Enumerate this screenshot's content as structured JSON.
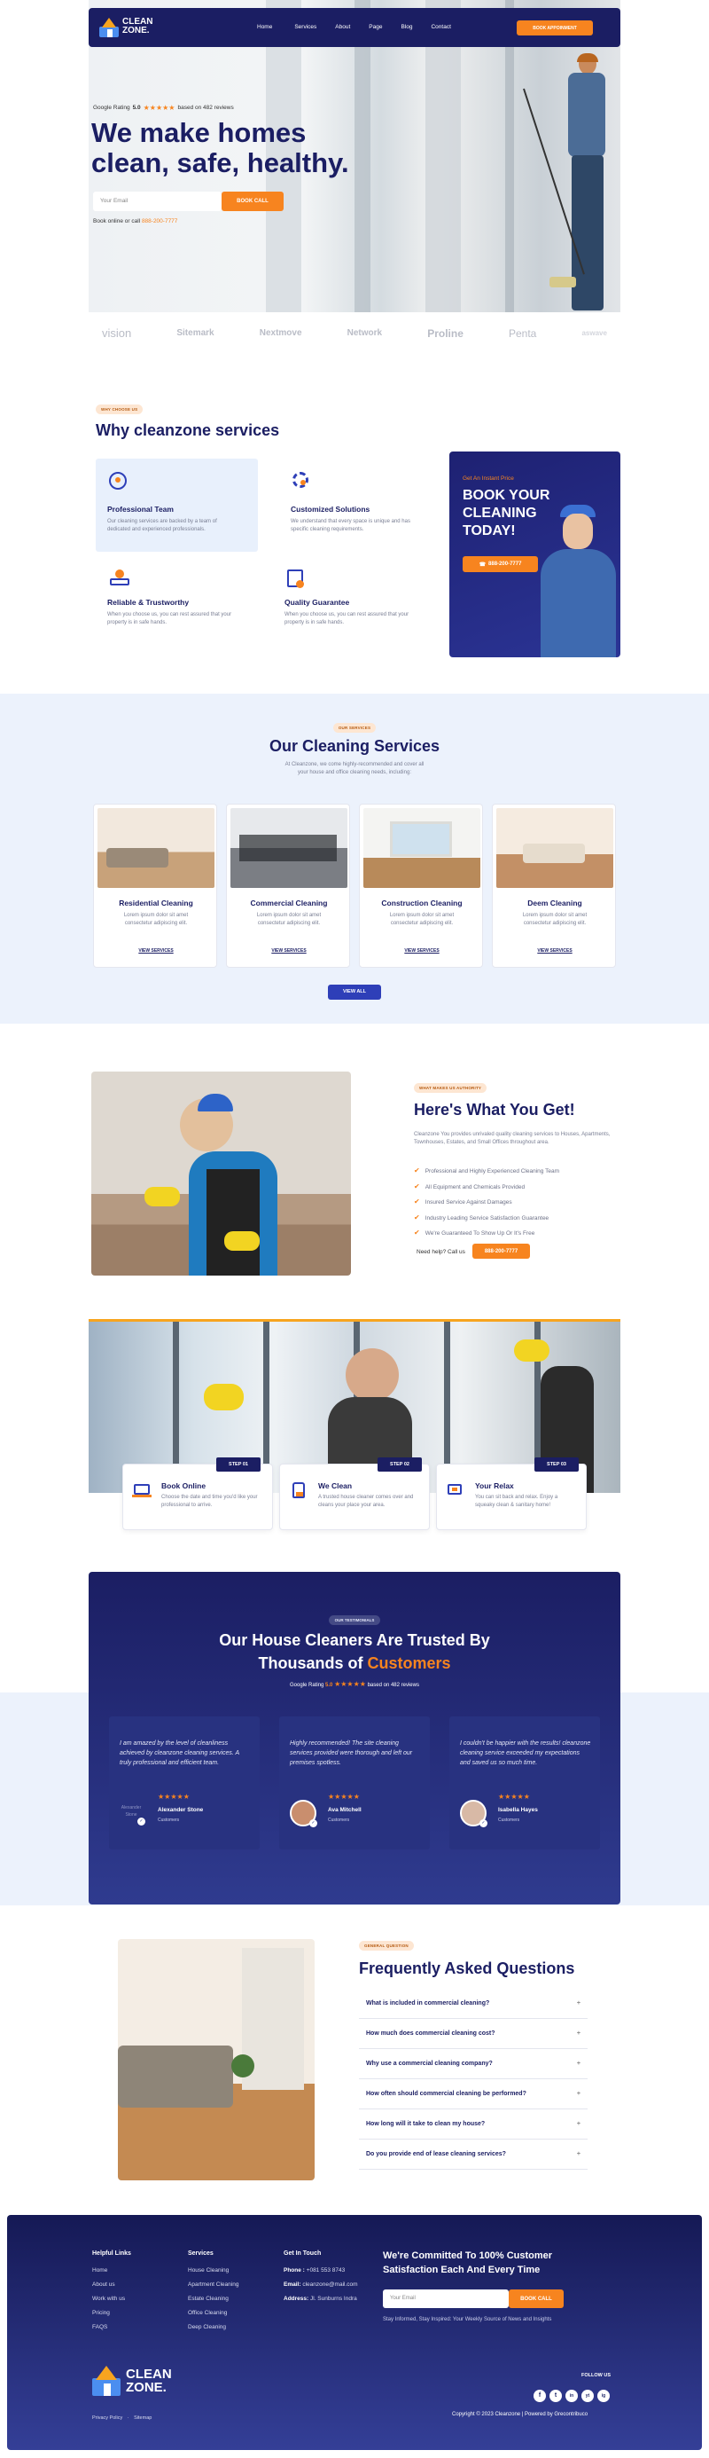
{
  "brand": {
    "logo_line1": "CLEAN",
    "logo_line2": "ZONE."
  },
  "nav": {
    "items": [
      "Home",
      "Services",
      "About",
      "Page",
      "Blog",
      "Contact"
    ],
    "cta": "BOOK APPOINMENT"
  },
  "hero": {
    "rating_label": "Google Rating",
    "rating_value": "5.0",
    "stars": "★★★★★",
    "rating_suffix": "based on 482 reviews",
    "title_line1": "We make homes",
    "title_line2": "clean, safe, healthy.",
    "email_placeholder": "Your Email",
    "book_button": "BOOK CALL",
    "call_label": "Book online or call",
    "call_number": "888-200-7777"
  },
  "partners": [
    "vision",
    "Sitemark",
    "Nextmove",
    "Network",
    "Proline",
    "Penta",
    "aswave"
  ],
  "why": {
    "pill": "WHY CHOOSE US",
    "title": "Why cleanzone services",
    "features": [
      {
        "title": "Professional Team",
        "desc": "Our cleaning services are backed by a team of dedicated and experienced professionals."
      },
      {
        "title": "Customized Solutions",
        "desc": "We understand that every space is unique and has specific cleaning requirements."
      },
      {
        "title": "Reliable & Trustworthy",
        "desc": "When you choose us, you can rest assured that your property is in safe hands."
      },
      {
        "title": "Quality Guarantee",
        "desc": "When you choose us, you can rest assured that your property is in safe hands."
      }
    ],
    "promo_kicker": "Get An Instant Price",
    "promo_title": "BOOK YOUR CLEANING TODAY!",
    "promo_phone": "888-200-7777"
  },
  "services": {
    "pill": "OUR SERVICES",
    "title": "Our Cleaning Services",
    "desc1": "At Cleanzone, we come highly-recommended and cover all",
    "desc2": "your house and office cleaning needs, including:",
    "items": [
      {
        "title": "Residential Cleaning",
        "desc": "Lorem ipsum dolor sit amet consectetur adipiscing elit.",
        "link": "VIEW SERVICES"
      },
      {
        "title": "Commercial Cleaning",
        "desc": "Lorem ipsum dolor sit amet consectetur adipiscing elit.",
        "link": "VIEW SERVICES"
      },
      {
        "title": "Construction Cleaning",
        "desc": "Lorem ipsum dolor sit amet consectetur adipiscing elit.",
        "link": "VIEW SERVICES"
      },
      {
        "title": "Deem Cleaning",
        "desc": "Lorem ipsum dolor sit amet consectetur adipiscing elit.",
        "link": "VIEW SERVICES"
      }
    ],
    "view_all": "VIEW ALL"
  },
  "about": {
    "pill": "WHAT MAKES US AUTHORITY",
    "title": "Here's What You Get!",
    "desc": "Cleanzone You provides unrivaled quality cleaning services to Houses, Apartments, Townhouses, Estates, and Small Offices throughout area.",
    "checks": [
      "Professional and Highly Experienced Cleaning Team",
      "All Equipment and Chemicals Provided",
      "Insured Service Against Damages",
      "Industry Leading Service Satisfaction Guarantee",
      "We're Guaranteed To Show Up Or It's Free"
    ],
    "need_help": "Need help? Call us",
    "phone": "888-200-7777"
  },
  "steps": [
    {
      "badge": "STEP 01",
      "title": "Book Online",
      "desc": "Choose the date and time you'd like your professional to arrive."
    },
    {
      "badge": "STEP 02",
      "title": "We Clean",
      "desc": "A trusted house cleaner comes over and cleans your place your area."
    },
    {
      "badge": "STEP 03",
      "title": "Your Relax",
      "desc": "You can sit back and relax. Enjoy a squeaky clean & sanitary home!"
    }
  ],
  "testimonials": {
    "pill": "OUR TESTIMONIALS",
    "title_line1": "Our House Cleaners Are Trusted By",
    "title_line2_pre": "Thousands of",
    "title_line2_accent": "Customers",
    "rating_label": "Google Rating",
    "rating_value": "5.0",
    "stars": "★★★★★",
    "rating_suffix": "based on 482 reviews",
    "items": [
      {
        "quote": "I am amazed by the level of cleanliness achieved by cleanzone cleaning services. A truly professional and efficient team.",
        "stars": "★★★★★",
        "name": "Alexander Stone",
        "role": "Customers"
      },
      {
        "quote": "Highly recommended! The site cleaning services provided were thorough and left our premises spotless.",
        "stars": "★★★★★",
        "name": "Ava Mitchell",
        "role": "Customers"
      },
      {
        "quote": "I couldn't be happier with the results! cleanzone cleaning service exceeded my expectations and saved us so much time.",
        "stars": "★★★★★",
        "name": "Isabella Hayes",
        "role": "Customers"
      }
    ],
    "avatar_alt": "Alexander Stone"
  },
  "faq": {
    "pill": "GENERAL QUESTION",
    "title": "Frequently Asked Questions",
    "items": [
      "What is included in commercial cleaning?",
      "How much does commercial cleaning cost?",
      "Why use a commercial cleaning company?",
      "How often should commercial cleaning be performed?",
      "How long will it take to clean my house?",
      "Do you provide end of lease cleaning services?"
    ]
  },
  "footer": {
    "helpful_title": "Helpful Links",
    "helpful": [
      "Home",
      "About us",
      "Work with us",
      "Pricing",
      "FAQS"
    ],
    "services_title": "Services",
    "services": [
      "House Cleaning",
      "Apartment Cleaning",
      "Estate Cleaning",
      "Office Cleaning",
      "Deep Cleaning"
    ],
    "contact_title": "Get In Touch",
    "phone_label": "Phone :",
    "phone": "+081 553 8743",
    "email_label": "Email:",
    "email": "cleanzone@mail.com",
    "address_label": "Address:",
    "address": "Jl. Sunburns Indra",
    "committed_line1": "We're Committed To 100% Customer",
    "committed_line2": "Satisfaction Each And Every Time",
    "email_placeholder": "Your Email",
    "book_button": "BOOK CALL",
    "newsletter": "Stay Informed, Stay Inspired: Your Weekly Source of News and Insights",
    "follow": "FOLLOW US",
    "social": [
      "f",
      "t",
      "in",
      "yt",
      "ig"
    ],
    "policy": "Privacy Policy",
    "sitemap": "Sitemap",
    "copyright": "Copyright © 2023 Cleanzone | Powered by Grecontribuco"
  },
  "colors": {
    "navy": "#1b1e63",
    "orange": "#f7841f",
    "royal": "#2e3fb8"
  }
}
